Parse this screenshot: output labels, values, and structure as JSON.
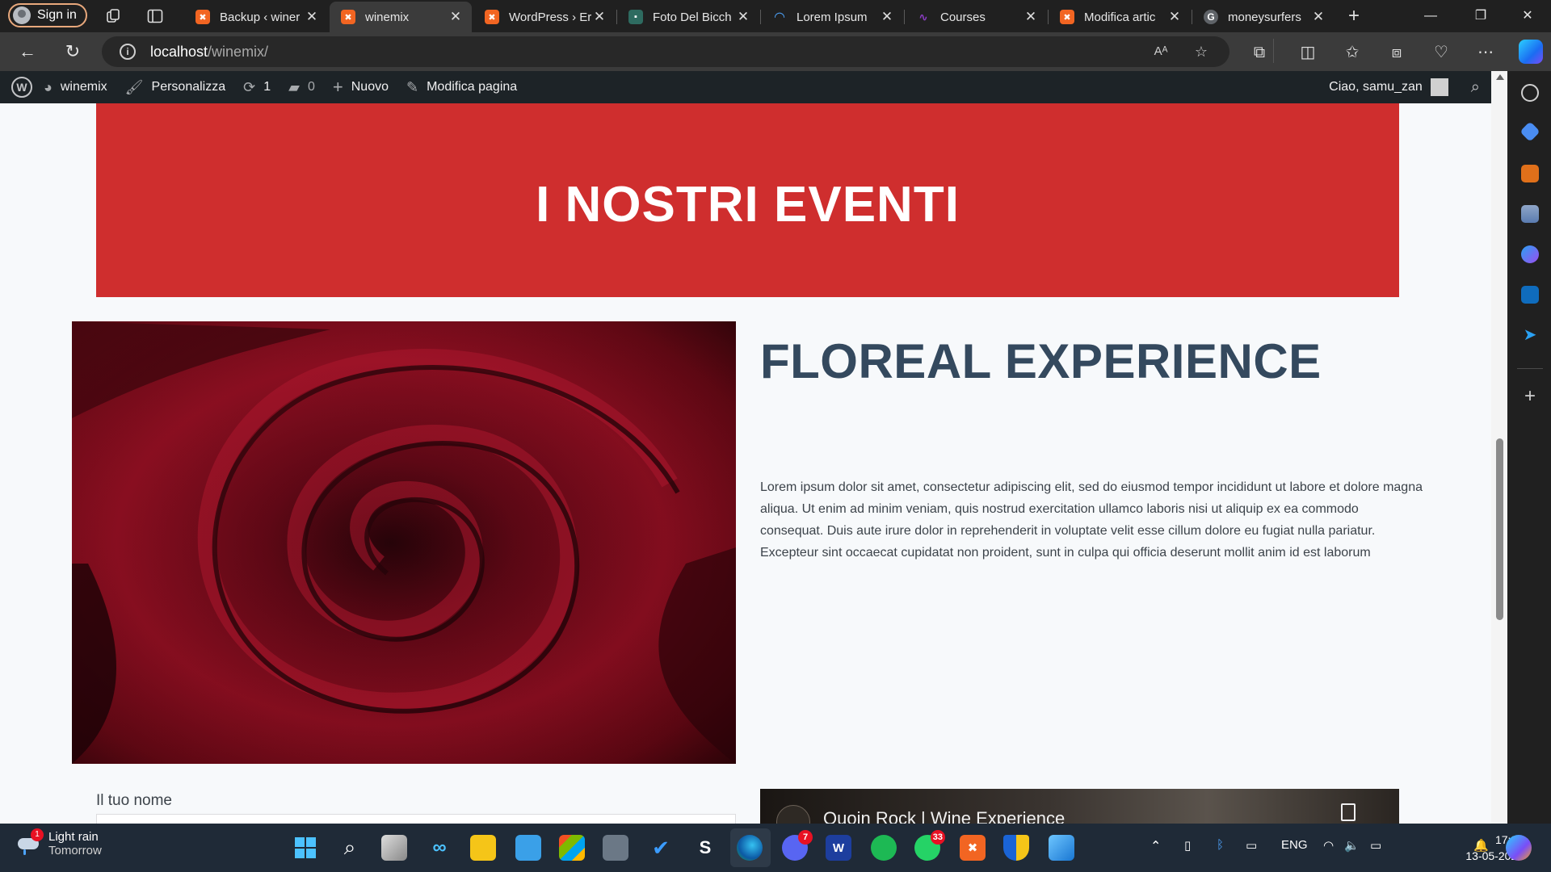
{
  "browser": {
    "signin_label": "Sign in",
    "tabs": [
      {
        "title": "Backup ‹ winer",
        "favicon": "xampp-icon",
        "color": "#f26522"
      },
      {
        "title": "winemix",
        "favicon": "xampp-icon",
        "color": "#f26522",
        "active": true
      },
      {
        "title": "WordPress › Er",
        "favicon": "xampp-icon",
        "color": "#f26522"
      },
      {
        "title": "Foto Del Bicch",
        "favicon": "photo-site-icon",
        "color": "#2e6b60"
      },
      {
        "title": "Lorem Ipsum",
        "favicon": "loading-spinner-icon",
        "color": "#4ea5ff"
      },
      {
        "title": "Courses",
        "favicon": "courses-icon",
        "color": "#6a2c91"
      },
      {
        "title": "Modifica artic",
        "favicon": "xampp-icon",
        "color": "#f26522"
      },
      {
        "title": "moneysurfers",
        "favicon": "google-icon",
        "color": "#7a7a7a"
      }
    ],
    "url_host": "localhost",
    "url_path": "/winemix/"
  },
  "wp_admin_bar": {
    "site_name": "winemix",
    "customize": "Personalizza",
    "updates_count": "1",
    "comments_count": "0",
    "new_label": "Nuovo",
    "edit_page": "Modifica pagina",
    "greeting": "Ciao, samu_zan"
  },
  "page": {
    "hero_title": "I NOSTRI EVENTI",
    "event_title": "FLOREAL EXPERIENCE",
    "event_text": "Lorem ipsum dolor sit amet, consectetur adipiscing elit, sed do eiusmod tempor incididunt ut labore et dolore magna aliqua. Ut enim ad minim veniam, quis nostrud exercitation ullamco laboris nisi ut aliquip ex ea commodo consequat. Duis aute irure dolor in reprehenderit in voluptate velit esse cillum dolore eu fugiat nulla pariatur. Excepteur sint occaecat cupidatat non proident, sunt in culpa qui officia deserunt mollit anim id est laborum",
    "form_name_label": "Il tuo nome",
    "video_title": "Quoin Rock | Wine Experience",
    "hero_color": "#cf2e2e"
  },
  "taskbar": {
    "weather_condition": "Light rain",
    "weather_when": "Tomorrow",
    "weather_badge": "1",
    "discord_badge": "7",
    "whatsapp_badge": "33",
    "language": "ENG",
    "time": "17:31",
    "date": "13-05-2024"
  }
}
